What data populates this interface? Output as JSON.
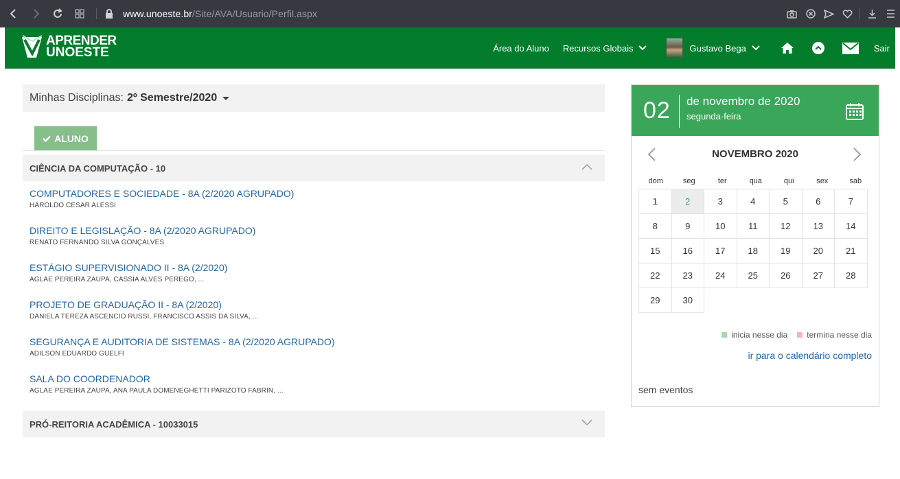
{
  "browser": {
    "url_domain": "www.unoeste.br",
    "url_path": "/Site/AVA/Usuario/Perfil.aspx"
  },
  "header": {
    "logo_line1": "APRENDER",
    "logo_line2": "UNOESTE",
    "menu": {
      "area_aluno": "Área do Aluno",
      "recursos": "Recursos Globais",
      "user_name": "Gustavo Bega",
      "sair": "Sair"
    },
    "brand_color": "#037d2c"
  },
  "main": {
    "disc_label": "Minhas Disciplinas:",
    "disc_semester": "2º Semestre/2020",
    "role_tab": "ALUNO",
    "groups": [
      {
        "name": "CIÊNCIA DA COMPUTAÇÃO - 10",
        "expanded": true,
        "courses": [
          {
            "title": "COMPUTADORES E SOCIEDADE - 8A (2/2020 AGRUPADO)",
            "professors": "HAROLDO CESAR ALESSI"
          },
          {
            "title": "DIREITO E LEGISLAÇÃO - 8A (2/2020 AGRUPADO)",
            "professors": "RENATO FERNANDO SILVA GONÇALVES"
          },
          {
            "title": "ESTÁGIO SUPERVISIONADO II - 8A (2/2020)",
            "professors": "AGLAE PEREIRA ZAUPA, CASSIA ALVES PEREGO, ..."
          },
          {
            "title": "PROJETO DE GRADUAÇÃO II - 8A (2/2020)",
            "professors": "DANIELA TEREZA ASCENCIO RUSSI, FRANCISCO ASSIS DA SILVA, ..."
          },
          {
            "title": "SEGURANÇA E AUDITORIA DE SISTEMAS - 8A (2/2020 AGRUPADO)",
            "professors": "ADILSON EDUARDO GUELFI"
          },
          {
            "title": "SALA DO COORDENADOR",
            "professors": "AGLAE PEREIRA ZAUPA, ANA PAULA DOMENEGHETTI PARIZOTO FABRIN, ..."
          }
        ]
      },
      {
        "name": "PRÓ-REITORIA ACADÊMICA - 10033015",
        "expanded": false,
        "courses": []
      }
    ]
  },
  "calendar": {
    "day": "02",
    "month_text": "de novembro de 2020",
    "weekday": "segunda-feira",
    "title": "NOVEMBRO 2020",
    "weekdays": [
      "dom",
      "seg",
      "ter",
      "qua",
      "qui",
      "sex",
      "sab"
    ],
    "weeks": [
      [
        "1",
        "2",
        "3",
        "4",
        "5",
        "6",
        "7"
      ],
      [
        "8",
        "9",
        "10",
        "11",
        "12",
        "13",
        "14"
      ],
      [
        "15",
        "16",
        "17",
        "18",
        "19",
        "20",
        "21"
      ],
      [
        "22",
        "23",
        "24",
        "25",
        "26",
        "27",
        "28"
      ],
      [
        "29",
        "30",
        "",
        "",
        "",
        "",
        ""
      ]
    ],
    "selected_day": "2",
    "legend_start": "inicia nesse dia",
    "legend_end": "termina nesse dia",
    "legend_start_color": "#a8d8ae",
    "legend_end_color": "#f4b6b6",
    "link": "ir para o calendário completo",
    "no_events": "sem eventos",
    "accent_color": "#3aa65a"
  }
}
